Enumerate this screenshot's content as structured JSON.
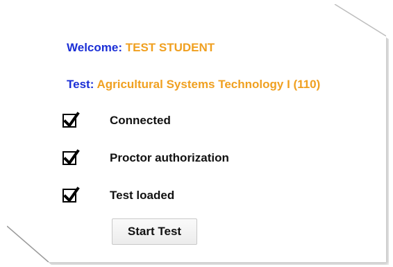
{
  "welcome": {
    "label": "Welcome:",
    "value": "TEST STUDENT"
  },
  "test": {
    "label": "Test:",
    "value": "Agricultural Systems Technology I (110)"
  },
  "checklist": [
    {
      "label": "Connected",
      "checked": true,
      "icon": "checkmark-icon"
    },
    {
      "label": "Proctor authorization",
      "checked": true,
      "icon": "checkmark-icon"
    },
    {
      "label": "Test loaded",
      "checked": true,
      "icon": "checkmark-icon"
    }
  ],
  "actions": {
    "start_label": "Start Test"
  },
  "colors": {
    "label_blue": "#1b2fd6",
    "value_orange": "#f0a020"
  }
}
